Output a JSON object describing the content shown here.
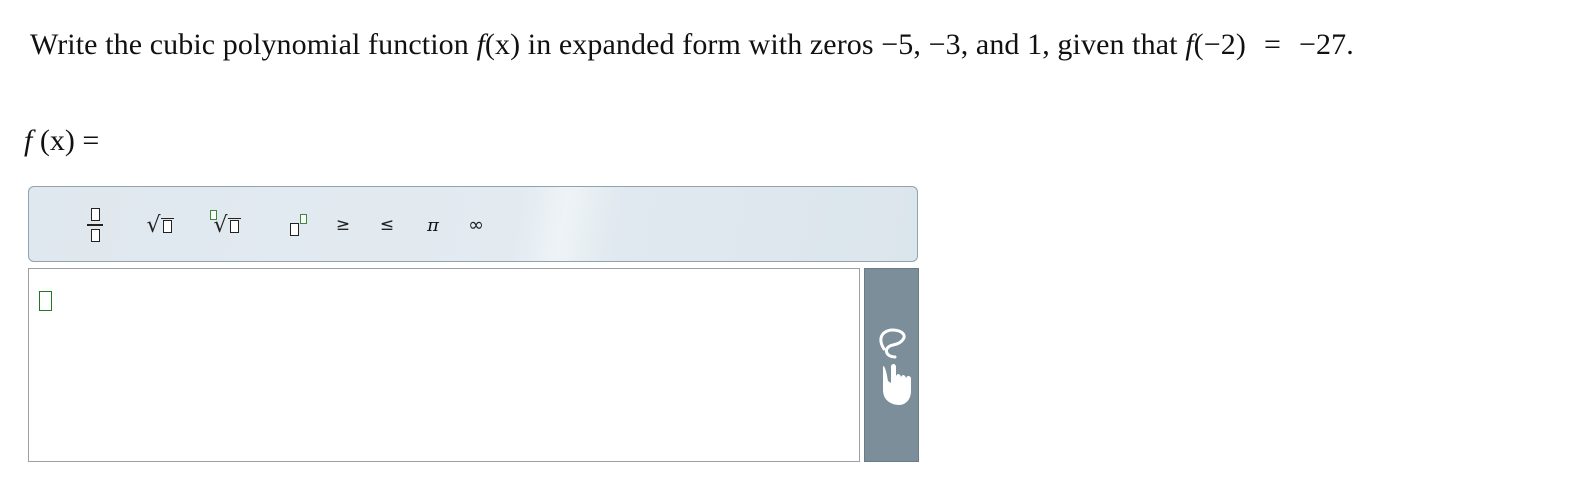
{
  "question": {
    "part1": "Write the cubic polynomial function ",
    "fname": "f",
    "fx_paren": "(x)",
    "part2": " in expanded form with zeros −5, −3, and 1, given that ",
    "fname2": "f",
    "fcond": "(−2)",
    "equals": "=",
    "value": "−27."
  },
  "answer_label": {
    "fname": "f",
    "arg": " (x)",
    "equals": " ="
  },
  "toolbar": {
    "ge": "≥",
    "le": "≤",
    "pi": "π",
    "inf": "∞",
    "radical": "√"
  },
  "icons": {
    "fraction": "fraction-icon",
    "sqrt": "square-root-icon",
    "nth_root": "nth-root-icon",
    "superscript": "superscript-icon",
    "handwriting": "handwriting-hand-icon"
  }
}
